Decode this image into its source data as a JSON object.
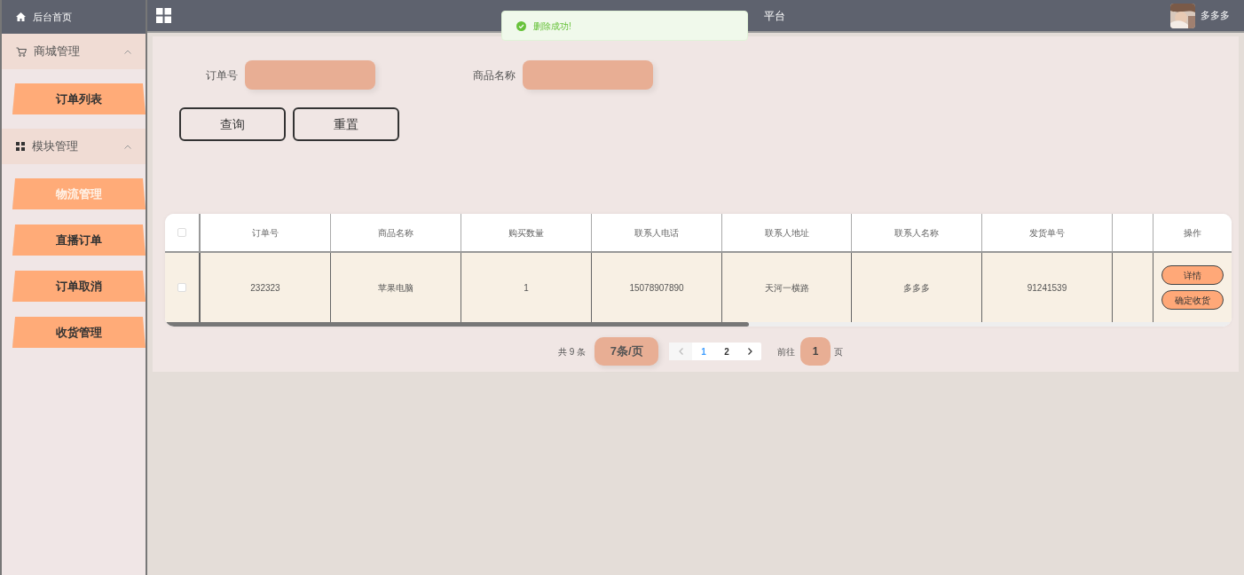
{
  "sidebar": {
    "home": "后台首页",
    "groups": [
      {
        "label": "商城管理",
        "expanded": true,
        "items": [
          {
            "label": "订单列表",
            "selected": false
          }
        ]
      },
      {
        "label": "模块管理",
        "expanded": true,
        "items": [
          {
            "label": "物流管理",
            "selected": true
          },
          {
            "label": "直播订单",
            "selected": false
          },
          {
            "label": "订单取消",
            "selected": false
          },
          {
            "label": "收货管理",
            "selected": false
          }
        ]
      }
    ]
  },
  "header": {
    "title": "平台",
    "user": "多多多"
  },
  "toast": {
    "message": "删除成功!"
  },
  "search": {
    "fields": [
      {
        "label": "订单号"
      },
      {
        "label": "商品名称"
      }
    ],
    "buttons": [
      "查询",
      "重置"
    ]
  },
  "table": {
    "columns": [
      "订单号",
      "商品名称",
      "购买数量",
      "联系人电话",
      "联系人地址",
      "联系人名称",
      "发货单号",
      "",
      "操作"
    ],
    "rows": [
      {
        "checked": false,
        "cells": [
          "232323",
          "苹果电脑",
          "1",
          "15078907890",
          "天河一横路",
          "多多多",
          "91241539"
        ],
        "actions": [
          "详情",
          "确定收货"
        ]
      }
    ],
    "header_checked": false
  },
  "pagination": {
    "total": "共 9 条",
    "page_size": "7条/页",
    "pages": [
      {
        "label": "1",
        "selected": true
      },
      {
        "label": "2",
        "selected": false
      }
    ],
    "goto": "前往",
    "goto_value": "1",
    "goto_unit": "页"
  }
}
